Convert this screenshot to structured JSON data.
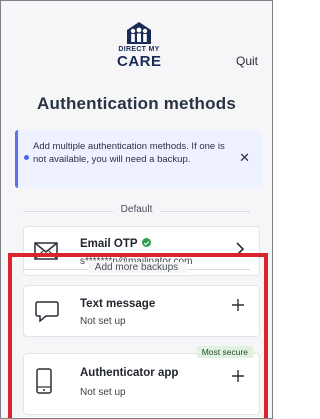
{
  "header": {
    "logo_line1": "DIRECT MY",
    "logo_line2": "CARE",
    "quit_label": "Quit"
  },
  "page": {
    "title": "Authentication methods"
  },
  "alert": {
    "message": "Add multiple authentication methods. If one is not available, you will need a backup.",
    "close_icon": "close-icon",
    "accent_color": "#5b73e8"
  },
  "default_section": {
    "label": "Default",
    "method": {
      "name": "Email OTP",
      "value": "s*******n@mailinator.com",
      "icon": "envelope-icon",
      "status_icon": "check-circle-icon",
      "status_color": "#2f9e52"
    }
  },
  "backups_section": {
    "label": "Add more backups",
    "methods": [
      {
        "name": "Text message",
        "status": "Not set up",
        "icon": "chat-bubble-icon"
      },
      {
        "name": "Authenticator app",
        "status": "Not set up",
        "icon": "phone-icon",
        "badge": "Most secure",
        "badge_color": "#dff2df"
      }
    ]
  },
  "highlight_color": "#d9252d"
}
